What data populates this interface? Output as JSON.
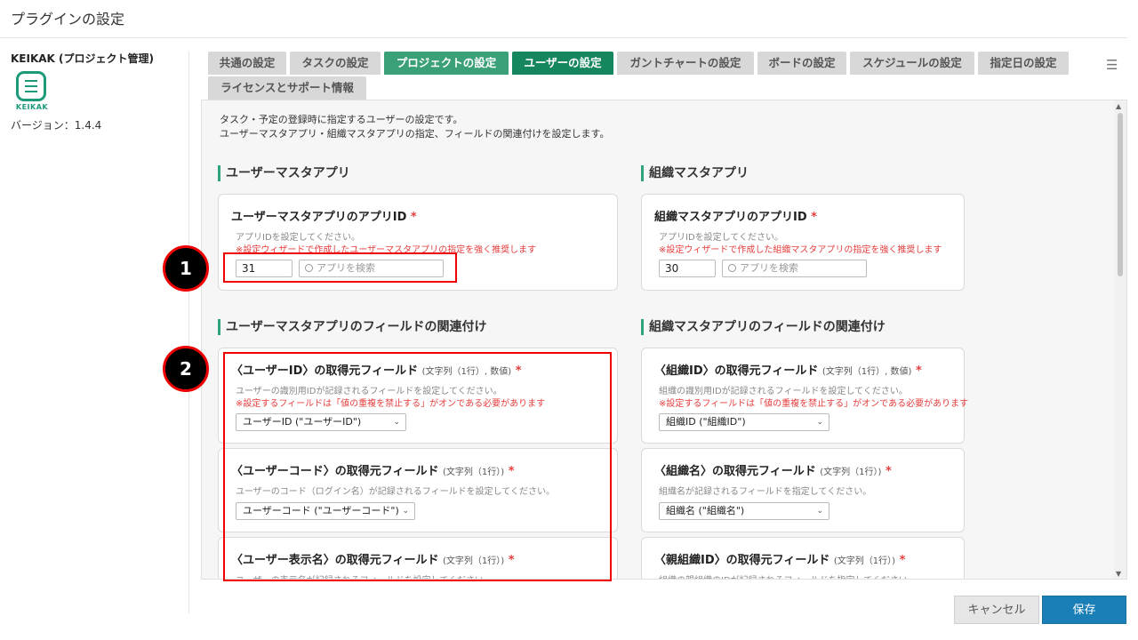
{
  "page": {
    "title": "プラグインの設定"
  },
  "plugin": {
    "name": "KEIKAK (プロジェクト管理)",
    "logo_text": "KEIKAK",
    "version": "バージョン：1.4.4"
  },
  "tabs": [
    {
      "label": "共通の設定"
    },
    {
      "label": "タスクの設定"
    },
    {
      "label": "プロジェクトの設定"
    },
    {
      "label": "ユーザーの設定"
    },
    {
      "label": "ガントチャートの設定"
    },
    {
      "label": "ボードの設定"
    },
    {
      "label": "スケジュールの設定"
    },
    {
      "label": "指定日の設定"
    },
    {
      "label": "ライセンスとサポート情報"
    }
  ],
  "intro": {
    "line1": "タスク・予定の登録時に指定するユーザーの設定です。",
    "line2": "ユーザーマスタアプリ・組織マスタアプリの指定、フィールドの関連付けを設定します。"
  },
  "user_master": {
    "heading": "ユーザーマスタアプリ",
    "card_title": "ユーザーマスタアプリのアプリID",
    "help": "アプリIDを設定してください。",
    "warn": "※設定ウィザードで作成したユーザーマスタアプリの指定を強く推奨します",
    "app_id": "31",
    "search_placeholder": "アプリを検索"
  },
  "org_master": {
    "heading": "組織マスタアプリ",
    "card_title": "組織マスタアプリのアプリID",
    "help": "アプリIDを設定してください。",
    "warn": "※設定ウィザードで作成した組織マスタアプリの指定を強く推奨します",
    "app_id": "30",
    "search_placeholder": "アプリを検索"
  },
  "user_fields": {
    "heading": "ユーザーマスタアプリのフィールドの関連付け",
    "cards": [
      {
        "title": "〈ユーザーID〉の取得元フィールド",
        "type": "(文字列（1行）, 数値)",
        "help": "ユーザーの識別用IDが記録されるフィールドを設定してください。",
        "warn": "※設定するフィールドは「値の重複を禁止する」がオンである必要があります",
        "value": "ユーザーID (\"ユーザーID\")"
      },
      {
        "title": "〈ユーザーコード〉の取得元フィールド",
        "type": "(文字列（1行）)",
        "help": "ユーザーのコード（ログイン名）が記録されるフィールドを設定してください。",
        "value": "ユーザーコード (\"ユーザーコード\")"
      },
      {
        "title": "〈ユーザー表示名〉の取得元フィールド",
        "type": "(文字列（1行）)",
        "help": "ユーザーの表示名が記録されるフィールドを設定してください。"
      }
    ]
  },
  "org_fields": {
    "heading": "組織マスタアプリのフィールドの関連付け",
    "cards": [
      {
        "title": "〈組織ID〉の取得元フィールド",
        "type": "(文字列（1行）, 数値)",
        "help": "組織の識別用IDが記録されるフィールドを設定してください。",
        "warn": "※設定するフィールドは「値の重複を禁止する」がオンである必要があります",
        "value": "組織ID (\"組織ID\")"
      },
      {
        "title": "〈組織名〉の取得元フィールド",
        "type": "(文字列（1行）)",
        "help": "組織名が記録されるフィールドを指定してください。",
        "value": "組織名 (\"組織名\")"
      },
      {
        "title": "〈親組織ID〉の取得元フィールド",
        "type": "(文字列（1行）)",
        "help": "組織の親組織のIDが記録されるフィールドを指定してください。"
      }
    ]
  },
  "markers": {
    "m1": "1",
    "m2": "2"
  },
  "actions": {
    "cancel": "キャンセル",
    "save": "保存"
  },
  "required_mark": "*",
  "colors": {
    "accent_green": "#16865e",
    "save_blue": "#1a7eb7",
    "required_red": "#e53e3e"
  }
}
